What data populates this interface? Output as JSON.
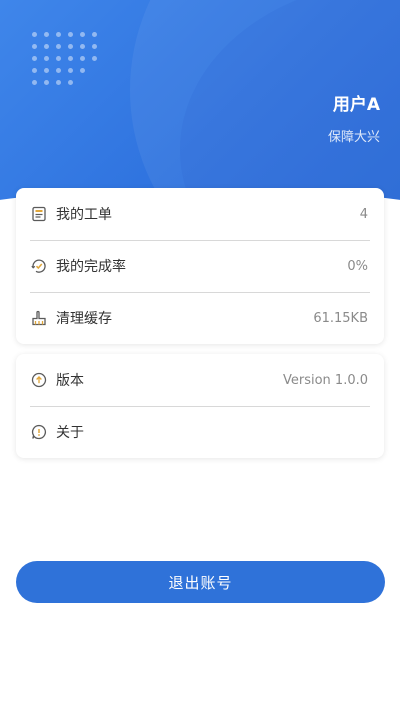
{
  "header": {
    "user_name": "用户A",
    "organization": "保障大兴",
    "background_color": "#2f73df"
  },
  "menu_group_1": [
    {
      "icon": "document-icon",
      "label": "我的工单",
      "value": "4"
    },
    {
      "icon": "completion-rate-icon",
      "label": "我的完成率",
      "value": "0%"
    },
    {
      "icon": "broom-icon",
      "label": "清理缓存",
      "value": "61.15KB"
    }
  ],
  "menu_group_2": [
    {
      "icon": "upload-info-icon",
      "label": "版本",
      "value": "Version 1.0.0"
    },
    {
      "icon": "about-icon",
      "label": "关于",
      "value": ""
    }
  ],
  "logout": {
    "label": "退出账号",
    "color": "#2f72d9"
  },
  "accent_icon_color": "#d9a037"
}
